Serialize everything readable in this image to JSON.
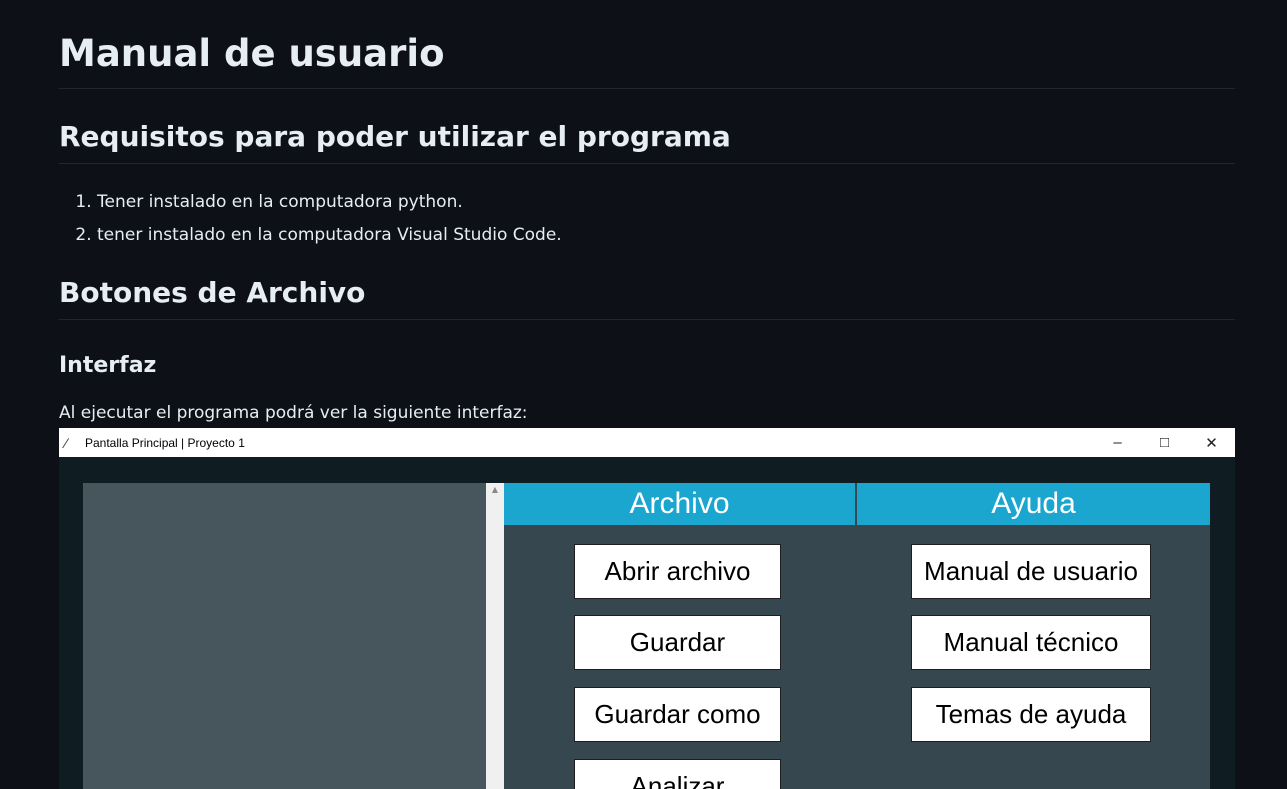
{
  "doc": {
    "title": "Manual de usuario",
    "requirements_heading": "Requisitos para poder utilizar el programa",
    "requirements": [
      "Tener instalado en la computadora python.",
      "tener instalado en la computadora Visual Studio Code."
    ],
    "file_buttons_heading": "Botones de Archivo",
    "interface_heading": "Interfaz",
    "interface_text": "Al ejecutar el programa podrá ver la siguiente interfaz:"
  },
  "window": {
    "title": "Pantalla Principal | Proyecto 1",
    "icons": {
      "app": "feather-icon",
      "minimize": "minimize-icon",
      "maximize": "maximize-icon",
      "close": "close-icon"
    },
    "menu": {
      "archivo_header": "Archivo",
      "ayuda_header": "Ayuda",
      "archivo_buttons": [
        "Abrir archivo",
        "Guardar",
        "Guardar como",
        "Analizar"
      ],
      "ayuda_buttons": [
        "Manual de usuario",
        "Manual técnico",
        "Temas de ayuda"
      ]
    }
  },
  "colors": {
    "page_bg": "#0d1117",
    "header_accent": "#1ba6cf",
    "panel_bg": "#37474f",
    "editor_bg": "#47555c"
  }
}
